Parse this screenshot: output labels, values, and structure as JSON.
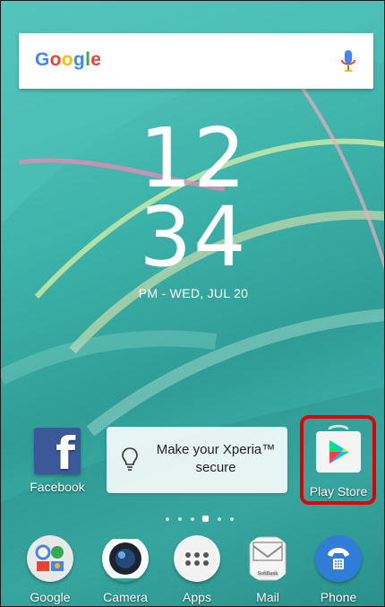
{
  "search": {
    "logo": "Google",
    "logo_colors": [
      "#4285F4",
      "#EA4335",
      "#FBBC05",
      "#4285F4",
      "#34A853",
      "#EA4335"
    ],
    "mic_icon": "mic-icon"
  },
  "clock": {
    "hour": "12",
    "minute": "34",
    "date": "PM - WED, JUL 20"
  },
  "home_apps": [
    {
      "label": "Facebook",
      "icon": "facebook-icon"
    },
    {
      "label": "Play Store",
      "icon": "play-store-icon"
    }
  ],
  "widget": {
    "text": "Make your Xperia™ secure",
    "icon": "lightbulb-icon"
  },
  "dock": [
    {
      "label": "Google",
      "icon": "google-folder-icon"
    },
    {
      "label": "Camera",
      "icon": "camera-icon"
    },
    {
      "label": "Apps",
      "icon": "apps-icon"
    },
    {
      "label": "Mail",
      "icon": "mail-icon",
      "sub": "SoftBank"
    },
    {
      "label": "Phone",
      "icon": "phone-icon"
    }
  ],
  "colors": {
    "highlight": "#e00000",
    "facebook": "#3b5998",
    "phone": "#2f7dd6"
  }
}
